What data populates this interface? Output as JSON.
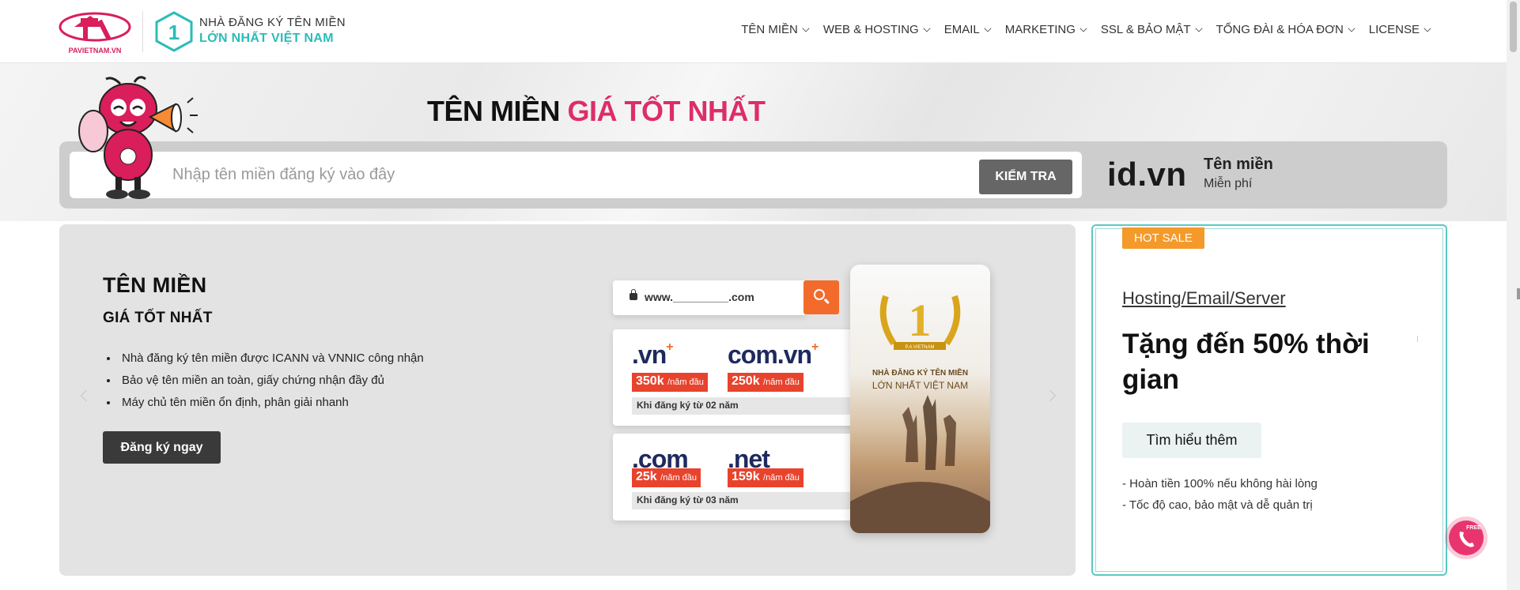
{
  "header": {
    "logo_text": "PAVIETNAM.VN",
    "badge_number": "1",
    "tagline_line1": "NHÀ ĐĂNG KÝ TÊN MIỀN",
    "tagline_line2": "LỚN NHẤT VIỆT NAM",
    "nav": [
      {
        "label": "TÊN MIỀN"
      },
      {
        "label": "WEB & HOSTING"
      },
      {
        "label": "EMAIL"
      },
      {
        "label": "MARKETING"
      },
      {
        "label": "SSL & BẢO MẬT"
      },
      {
        "label": "TỔNG ĐÀI & HÓA ĐƠN"
      },
      {
        "label": "LICENSE"
      }
    ]
  },
  "banner": {
    "title_black": "TÊN MIỀN",
    "title_pink": "GIÁ TỐT NHẤT",
    "search_placeholder": "Nhập tên miền đăng ký vào đây",
    "check_button": "KIỂM TRA",
    "promo_domain": "id.vn",
    "promo_line1": "Tên miền",
    "promo_line2": "Miễn phí"
  },
  "slide": {
    "heading": "TÊN MIỀN",
    "subheading": "GIÁ TỐT NHẤT",
    "bullets": [
      "Nhà đăng ký tên miền được ICANN và VNNIC công nhận",
      "Bảo vệ tên miền an toàn, giấy chứng nhận đầy đủ",
      "Máy chủ tên miền ổn định, phân giải nhanh"
    ],
    "cta": "Đăng ký ngay",
    "url_bar_text": "www._________.com",
    "cards": [
      {
        "tlds": [
          {
            "name": ".vn",
            "price": "350k",
            "unit": "/năm đầu"
          },
          {
            "name": "com.vn",
            "price": "250k",
            "unit": "/năm đầu"
          }
        ],
        "note": "Khi đăng ký từ 02 năm"
      },
      {
        "tlds": [
          {
            "name": ".com",
            "price": "25k",
            "unit": "/năm đầu"
          },
          {
            "name": ".net",
            "price": "159k",
            "unit": "/năm đầu"
          }
        ],
        "note": "Khi đăng ký từ 03 năm"
      }
    ],
    "award_brand": "P.A VIETNAM",
    "award_line1": "NHÀ ĐĂNG KÝ TÊN MIỀN",
    "award_line2": "LỚN NHẤT VIỆT NAM"
  },
  "hot_sale": {
    "tag": "HOT SALE",
    "subtitle": "Hosting/Email/Server",
    "title": "Tặng đến 50% thời gian",
    "button": "Tìm hiểu thêm",
    "points": [
      "- Hoàn tiền 100% nếu không hài lòng",
      "- Tốc độ cao, bảo mật và dễ quản trị"
    ]
  },
  "floating": {
    "free_label": "FREE"
  },
  "colors": {
    "accent_pink": "#dd2d6a",
    "teal": "#2bbcb8",
    "orange": "#f26b2b",
    "price_red": "#e8432d",
    "hot_sale_orange": "#f49a2b"
  }
}
